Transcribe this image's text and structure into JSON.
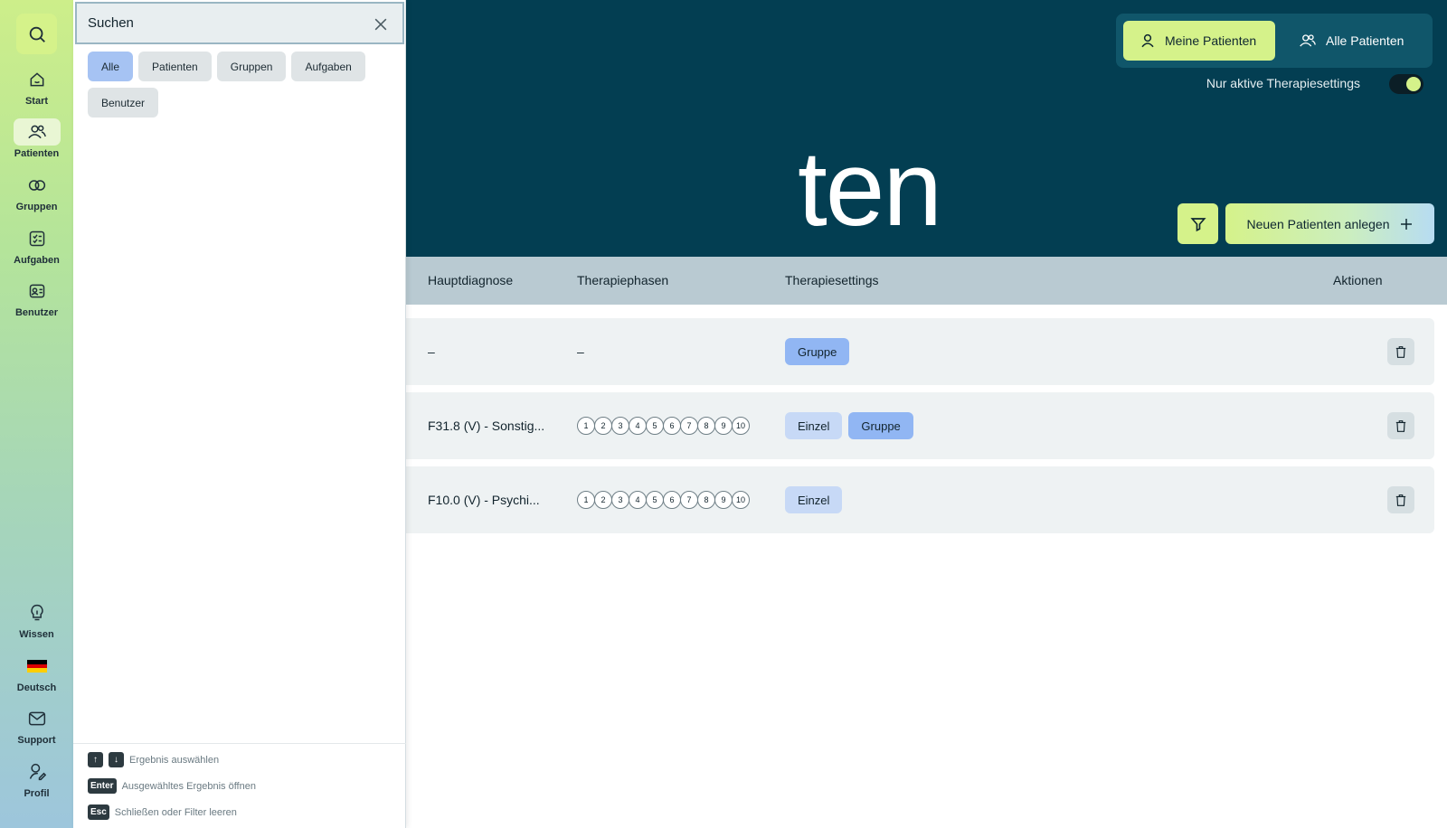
{
  "sidebar": {
    "items": [
      {
        "label": "Start",
        "icon": "home-icon"
      },
      {
        "label": "Patienten",
        "icon": "users-icon",
        "active": true
      },
      {
        "label": "Gruppen",
        "icon": "groups-icon"
      },
      {
        "label": "Aufgaben",
        "icon": "tasks-icon"
      },
      {
        "label": "Benutzer",
        "icon": "user-card-icon"
      }
    ],
    "bottom": [
      {
        "label": "Wissen",
        "icon": "lightbulb-icon"
      },
      {
        "label": "Deutsch",
        "icon": "german-flag-icon"
      },
      {
        "label": "Support",
        "icon": "mail-icon"
      },
      {
        "label": "Profil",
        "icon": "profile-icon"
      }
    ]
  },
  "header": {
    "title_fragment": "ten",
    "my_patients": "Meine Patienten",
    "all_patients": "Alle Patienten",
    "active_settings_label": "Nur aktive Therapiesettings",
    "active_settings_on": true,
    "new_patient": "Neuen Patienten anlegen"
  },
  "table": {
    "columns": {
      "diagnosis": "Hauptdiagnose",
      "phases": "Therapiephasen",
      "settings": "Therapiesettings",
      "actions": "Aktionen"
    },
    "rows": [
      {
        "diagnosis": "–",
        "phases_text": "–",
        "settings": [
          "Gruppe"
        ]
      },
      {
        "diagnosis": "F31.8 (V) - Sonstig...",
        "phases": [
          "1",
          "2",
          "3",
          "4",
          "5",
          "6",
          "7",
          "8",
          "9",
          "10"
        ],
        "settings": [
          "Einzel",
          "Gruppe"
        ]
      },
      {
        "diagnosis": "F10.0 (V) - Psychi...",
        "phases": [
          "1",
          "2",
          "3",
          "4",
          "5",
          "6",
          "7",
          "8",
          "9",
          "10"
        ],
        "settings": [
          "Einzel"
        ]
      }
    ]
  },
  "search": {
    "placeholder": "Suchen",
    "filters": [
      "Alle",
      "Patienten",
      "Gruppen",
      "Aufgaben",
      "Benutzer"
    ],
    "active_filter": "Alle",
    "hints": {
      "select": "Ergebnis auswählen",
      "enter_key": "Enter",
      "open": "Ausgewähltes Ergebnis öffnen",
      "esc_key": "Esc",
      "close": "Schließen oder Filter leeren"
    }
  },
  "colors": {
    "header_bg": "#033e52",
    "accent_lime": "#d5f28a",
    "chip_gruppe": "#91b6f3",
    "chip_einzel": "#c7d9f6"
  }
}
